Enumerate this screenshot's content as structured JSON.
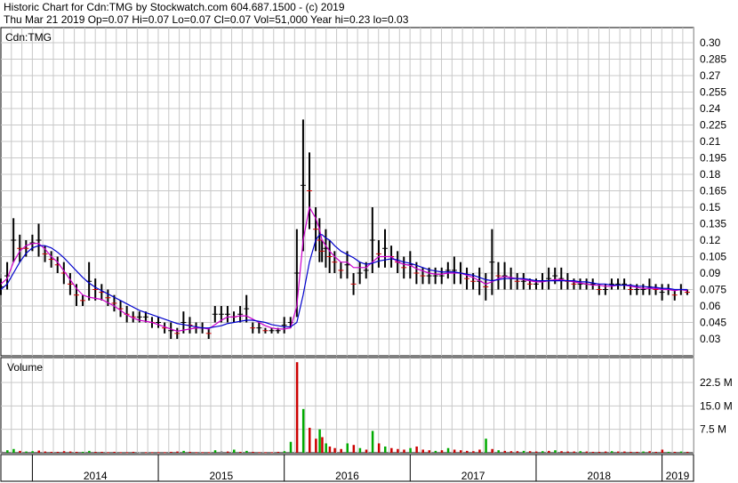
{
  "header": {
    "line1": "Historic Chart for Cdn:TMG by Stockwatch.com 604.687.1500 - (c) 2019",
    "line2": "Thu Mar 21 2019  Op=0.07  Hi=0.07  Lo=0.07  Cl=0.07  Vol=51,000  Year hi=0.23  lo=0.03"
  },
  "colors": {
    "grid": "#c8c8c8",
    "price_bar": "#000000",
    "price_bar_down": "#cc0000",
    "ma_short": "#cc00cc",
    "ma_long": "#0000cc",
    "vol_up": "#00aa00",
    "vol_down": "#cc0000",
    "vol_flat": "#888888"
  },
  "chart_data": [
    {
      "type": "line",
      "title": "Cdn:TMG",
      "ylim": [
        0.03,
        0.3
      ],
      "y_ticks": [
        "0.30",
        "0.285",
        "0.27",
        "0.255",
        "0.24",
        "0.225",
        "0.21",
        "0.195",
        "0.18",
        "0.165",
        "0.15",
        "0.135",
        "0.12",
        "0.105",
        "0.09",
        "0.075",
        "0.06",
        "0.045",
        "0.03"
      ],
      "x_ticks": [
        "2014",
        "2015",
        "2016",
        "2017",
        "2018",
        "2019"
      ],
      "xlim": [
        2013.75,
        2019.25
      ],
      "series": [
        {
          "x": [
            2013.75,
            2013.8,
            2013.85,
            2013.9,
            2013.95,
            2014.0,
            2014.05,
            2014.1,
            2014.15,
            2014.2,
            2014.25,
            2014.3,
            2014.35,
            2014.4,
            2014.45,
            2014.5,
            2014.55,
            2014.6,
            2014.65,
            2014.7,
            2014.75,
            2014.8,
            2014.85,
            2014.9,
            2014.95,
            2015.0,
            2015.05,
            2015.1,
            2015.15,
            2015.2,
            2015.25,
            2015.3,
            2015.35,
            2015.4,
            2015.45,
            2015.5,
            2015.55,
            2015.6,
            2015.65,
            2015.7,
            2015.75,
            2015.8,
            2015.85,
            2015.9,
            2015.95,
            2016.0,
            2016.05,
            2016.1,
            2016.15,
            2016.2,
            2016.25,
            2016.28,
            2016.3,
            2016.33,
            2016.36,
            2016.4,
            2016.45,
            2016.5,
            2016.55,
            2016.6,
            2016.65,
            2016.7,
            2016.75,
            2016.8,
            2016.85,
            2016.9,
            2016.95,
            2017.0,
            2017.05,
            2017.1,
            2017.15,
            2017.2,
            2017.25,
            2017.3,
            2017.35,
            2017.4,
            2017.45,
            2017.5,
            2017.55,
            2017.6,
            2017.65,
            2017.7,
            2017.75,
            2017.8,
            2017.85,
            2017.9,
            2017.95,
            2018.0,
            2018.05,
            2018.1,
            2018.15,
            2018.2,
            2018.25,
            2018.3,
            2018.35,
            2018.4,
            2018.45,
            2018.5,
            2018.55,
            2018.6,
            2018.65,
            2018.7,
            2018.75,
            2018.8,
            2018.85,
            2018.9,
            2018.95,
            2019.0,
            2019.05,
            2019.1,
            2019.15,
            2019.2
          ],
          "high": [
            0.085,
            0.1,
            0.14,
            0.125,
            0.12,
            0.125,
            0.135,
            0.115,
            0.11,
            0.105,
            0.1,
            0.09,
            0.08,
            0.07,
            0.1,
            0.085,
            0.08,
            0.075,
            0.07,
            0.065,
            0.06,
            0.055,
            0.055,
            0.055,
            0.05,
            0.05,
            0.045,
            0.045,
            0.04,
            0.055,
            0.05,
            0.045,
            0.045,
            0.04,
            0.06,
            0.06,
            0.06,
            0.055,
            0.06,
            0.07,
            0.045,
            0.045,
            0.04,
            0.04,
            0.04,
            0.05,
            0.05,
            0.13,
            0.23,
            0.2,
            0.15,
            0.14,
            0.12,
            0.13,
            0.12,
            0.11,
            0.1,
            0.11,
            0.09,
            0.1,
            0.1,
            0.15,
            0.12,
            0.13,
            0.115,
            0.11,
            0.105,
            0.11,
            0.1,
            0.095,
            0.095,
            0.095,
            0.095,
            0.1,
            0.105,
            0.1,
            0.095,
            0.09,
            0.095,
            0.09,
            0.13,
            0.1,
            0.1,
            0.095,
            0.09,
            0.09,
            0.085,
            0.085,
            0.09,
            0.095,
            0.095,
            0.095,
            0.09,
            0.085,
            0.085,
            0.085,
            0.085,
            0.08,
            0.08,
            0.085,
            0.085,
            0.085,
            0.08,
            0.08,
            0.08,
            0.085,
            0.08,
            0.08,
            0.08,
            0.075,
            0.08,
            0.075
          ],
          "low": [
            0.07,
            0.075,
            0.1,
            0.1,
            0.105,
            0.11,
            0.105,
            0.1,
            0.095,
            0.09,
            0.08,
            0.07,
            0.06,
            0.06,
            0.065,
            0.065,
            0.065,
            0.06,
            0.055,
            0.05,
            0.045,
            0.045,
            0.045,
            0.045,
            0.04,
            0.04,
            0.035,
            0.03,
            0.03,
            0.035,
            0.035,
            0.035,
            0.035,
            0.03,
            0.045,
            0.045,
            0.045,
            0.045,
            0.045,
            0.045,
            0.035,
            0.035,
            0.035,
            0.035,
            0.035,
            0.035,
            0.04,
            0.05,
            0.11,
            0.13,
            0.11,
            0.1,
            0.1,
            0.095,
            0.09,
            0.09,
            0.085,
            0.085,
            0.07,
            0.08,
            0.085,
            0.09,
            0.095,
            0.095,
            0.095,
            0.09,
            0.085,
            0.085,
            0.08,
            0.08,
            0.08,
            0.08,
            0.08,
            0.085,
            0.08,
            0.08,
            0.075,
            0.075,
            0.07,
            0.065,
            0.07,
            0.075,
            0.075,
            0.075,
            0.075,
            0.075,
            0.075,
            0.075,
            0.075,
            0.075,
            0.08,
            0.075,
            0.075,
            0.075,
            0.075,
            0.075,
            0.075,
            0.07,
            0.07,
            0.075,
            0.075,
            0.075,
            0.07,
            0.07,
            0.07,
            0.07,
            0.07,
            0.065,
            0.07,
            0.065,
            0.07,
            0.07
          ],
          "name": ""
        },
        {
          "name": "",
          "values": [
            0.08,
            0.085,
            0.1,
            0.11,
            0.115,
            0.117,
            0.117,
            0.112,
            0.105,
            0.1,
            0.092,
            0.084,
            0.076,
            0.07,
            0.068,
            0.067,
            0.066,
            0.063,
            0.06,
            0.056,
            0.052,
            0.049,
            0.047,
            0.046,
            0.045,
            0.043,
            0.041,
            0.039,
            0.037,
            0.038,
            0.039,
            0.04,
            0.04,
            0.039,
            0.043,
            0.047,
            0.05,
            0.05,
            0.051,
            0.051,
            0.048,
            0.045,
            0.042,
            0.04,
            0.039,
            0.039,
            0.04,
            0.06,
            0.12,
            0.15,
            0.14,
            0.13,
            0.12,
            0.115,
            0.11,
            0.105,
            0.1,
            0.1,
            0.095,
            0.095,
            0.095,
            0.1,
            0.105,
            0.105,
            0.105,
            0.1,
            0.098,
            0.097,
            0.094,
            0.092,
            0.09,
            0.089,
            0.089,
            0.09,
            0.09,
            0.09,
            0.088,
            0.086,
            0.083,
            0.08,
            0.082,
            0.085,
            0.087,
            0.086,
            0.085,
            0.084,
            0.083,
            0.082,
            0.082,
            0.083,
            0.084,
            0.084,
            0.083,
            0.082,
            0.081,
            0.08,
            0.079,
            0.079,
            0.078,
            0.078,
            0.079,
            0.079,
            0.078,
            0.077,
            0.076,
            0.076,
            0.076,
            0.075,
            0.075,
            0.074,
            0.075,
            0.074
          ]
        },
        {
          "name": "",
          "values": [
            0.075,
            0.08,
            0.09,
            0.1,
            0.108,
            0.113,
            0.115,
            0.115,
            0.113,
            0.109,
            0.104,
            0.098,
            0.092,
            0.086,
            0.081,
            0.077,
            0.074,
            0.071,
            0.068,
            0.065,
            0.062,
            0.059,
            0.056,
            0.054,
            0.052,
            0.05,
            0.048,
            0.046,
            0.044,
            0.043,
            0.042,
            0.041,
            0.04,
            0.04,
            0.041,
            0.042,
            0.044,
            0.045,
            0.046,
            0.047,
            0.047,
            0.046,
            0.045,
            0.043,
            0.042,
            0.041,
            0.041,
            0.045,
            0.07,
            0.1,
            0.12,
            0.125,
            0.125,
            0.122,
            0.12,
            0.115,
            0.11,
            0.107,
            0.104,
            0.1,
            0.098,
            0.099,
            0.101,
            0.102,
            0.103,
            0.102,
            0.1,
            0.099,
            0.097,
            0.095,
            0.093,
            0.092,
            0.091,
            0.091,
            0.091,
            0.09,
            0.089,
            0.088,
            0.086,
            0.084,
            0.083,
            0.084,
            0.085,
            0.085,
            0.085,
            0.085,
            0.084,
            0.083,
            0.083,
            0.083,
            0.083,
            0.083,
            0.083,
            0.083,
            0.082,
            0.082,
            0.081,
            0.08,
            0.08,
            0.079,
            0.079,
            0.079,
            0.079,
            0.078,
            0.078,
            0.077,
            0.077,
            0.076,
            0.076,
            0.075,
            0.075,
            0.075
          ]
        }
      ]
    },
    {
      "type": "bar",
      "title": "Volume",
      "ylim": [
        0,
        30
      ],
      "y_unit": "M",
      "y_ticks": [
        "22.5 M",
        "15.0 M",
        "7.5 M"
      ],
      "x": [
        2013.75,
        2013.8,
        2013.85,
        2013.9,
        2013.95,
        2014.0,
        2014.05,
        2014.1,
        2014.15,
        2014.2,
        2014.25,
        2014.3,
        2014.35,
        2014.4,
        2014.45,
        2014.5,
        2014.55,
        2014.6,
        2014.65,
        2014.7,
        2014.75,
        2014.8,
        2014.85,
        2014.9,
        2014.95,
        2015.0,
        2015.05,
        2015.1,
        2015.15,
        2015.2,
        2015.25,
        2015.3,
        2015.35,
        2015.4,
        2015.45,
        2015.5,
        2015.55,
        2015.6,
        2015.65,
        2015.7,
        2015.75,
        2015.8,
        2015.85,
        2015.9,
        2015.95,
        2016.0,
        2016.05,
        2016.1,
        2016.15,
        2016.2,
        2016.25,
        2016.28,
        2016.3,
        2016.33,
        2016.36,
        2016.4,
        2016.45,
        2016.5,
        2016.55,
        2016.6,
        2016.65,
        2016.7,
        2016.75,
        2016.8,
        2016.85,
        2016.9,
        2016.95,
        2017.0,
        2017.05,
        2017.1,
        2017.15,
        2017.2,
        2017.25,
        2017.3,
        2017.35,
        2017.4,
        2017.45,
        2017.5,
        2017.55,
        2017.6,
        2017.65,
        2017.7,
        2017.75,
        2017.8,
        2017.85,
        2017.9,
        2017.95,
        2018.0,
        2018.05,
        2018.1,
        2018.15,
        2018.2,
        2018.25,
        2018.3,
        2018.35,
        2018.4,
        2018.45,
        2018.5,
        2018.55,
        2018.6,
        2018.65,
        2018.7,
        2018.75,
        2018.8,
        2018.85,
        2018.9,
        2018.95,
        2019.0,
        2019.05,
        2019.1,
        2019.15,
        2019.2
      ],
      "values": [
        0.5,
        0.8,
        1.2,
        0.6,
        0.4,
        0.5,
        0.7,
        0.4,
        0.3,
        0.3,
        0.5,
        0.4,
        0.3,
        0.3,
        0.6,
        0.3,
        0.3,
        0.2,
        0.3,
        0.2,
        0.2,
        0.3,
        0.2,
        0.2,
        0.2,
        0.2,
        0.2,
        0.3,
        0.4,
        0.6,
        0.3,
        0.2,
        0.2,
        0.2,
        0.8,
        0.5,
        0.4,
        1.0,
        0.3,
        0.6,
        0.3,
        0.2,
        0.2,
        0.2,
        0.3,
        0.5,
        3.5,
        29.0,
        14.0,
        8.0,
        4.5,
        7.5,
        5.0,
        3.0,
        2.0,
        1.5,
        1.2,
        3.0,
        2.5,
        1.5,
        1.0,
        7.0,
        3.0,
        2.0,
        1.5,
        1.2,
        1.0,
        1.5,
        2.0,
        1.0,
        0.8,
        0.6,
        0.8,
        1.5,
        1.0,
        0.8,
        0.6,
        0.5,
        1.0,
        4.5,
        1.2,
        0.8,
        0.6,
        0.5,
        0.5,
        0.6,
        0.5,
        0.4,
        0.5,
        0.6,
        0.8,
        0.5,
        0.4,
        0.4,
        0.5,
        0.4,
        0.3,
        0.3,
        0.4,
        0.5,
        0.4,
        0.4,
        0.3,
        0.3,
        0.4,
        0.5,
        0.3,
        1.0,
        0.3,
        0.3,
        0.4,
        0.3
      ],
      "dir": [
        "f",
        "u",
        "u",
        "d",
        "u",
        "u",
        "d",
        "d",
        "d",
        "d",
        "d",
        "d",
        "d",
        "u",
        "u",
        "d",
        "d",
        "d",
        "d",
        "d",
        "d",
        "d",
        "f",
        "d",
        "d",
        "d",
        "d",
        "d",
        "d",
        "u",
        "d",
        "d",
        "d",
        "d",
        "u",
        "f",
        "d",
        "u",
        "d",
        "u",
        "d",
        "d",
        "d",
        "d",
        "d",
        "u",
        "u",
        "d",
        "u",
        "d",
        "d",
        "u",
        "d",
        "u",
        "d",
        "d",
        "d",
        "u",
        "d",
        "u",
        "d",
        "u",
        "d",
        "u",
        "d",
        "d",
        "d",
        "u",
        "d",
        "d",
        "d",
        "u",
        "d",
        "u",
        "d",
        "d",
        "d",
        "d",
        "d",
        "u",
        "d",
        "u",
        "d",
        "d",
        "d",
        "u",
        "d",
        "d",
        "u",
        "d",
        "u",
        "d",
        "d",
        "d",
        "u",
        "d",
        "d",
        "d",
        "d",
        "u",
        "d",
        "d",
        "d",
        "d",
        "u",
        "d",
        "d",
        "d",
        "u",
        "d",
        "u",
        "d"
      ]
    }
  ]
}
